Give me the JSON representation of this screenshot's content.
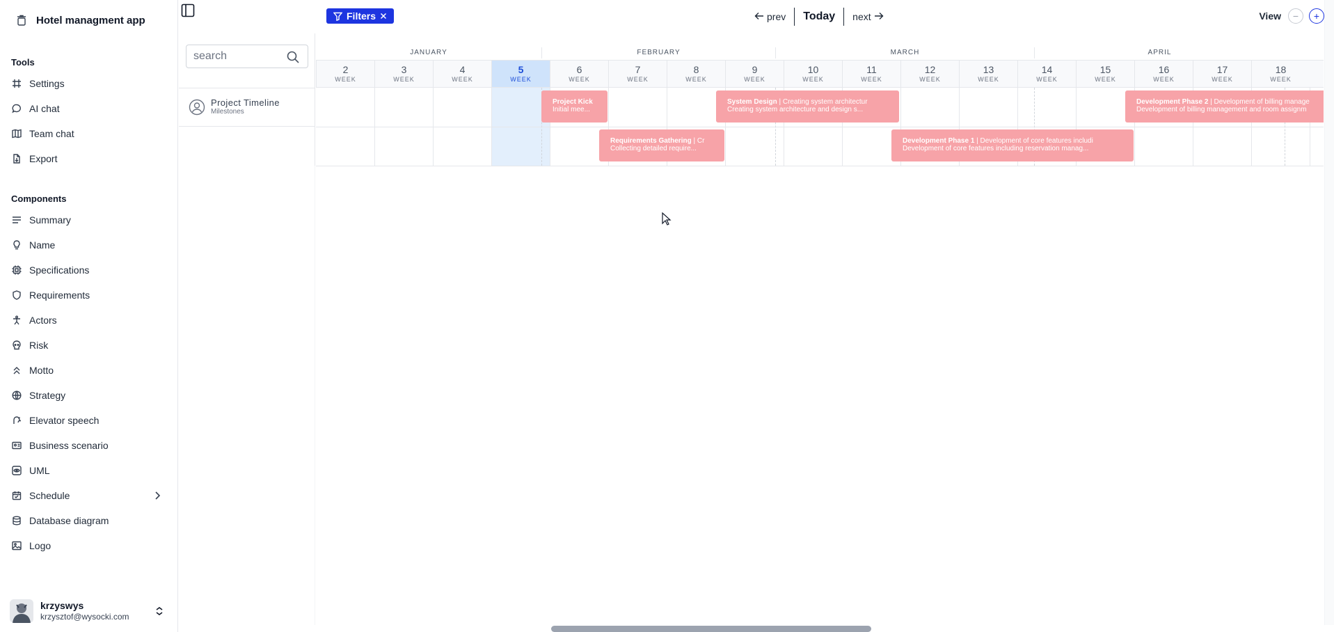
{
  "app": {
    "title": "Hotel managment app"
  },
  "sidebar": {
    "tools_label": "Tools",
    "tools": [
      {
        "label": "Settings",
        "icon": "hash-icon"
      },
      {
        "label": "AI chat",
        "icon": "chat-icon"
      },
      {
        "label": "Team chat",
        "icon": "book-icon"
      },
      {
        "label": "Export",
        "icon": "file-export-icon"
      }
    ],
    "components_label": "Components",
    "components": [
      {
        "label": "Summary",
        "icon": "lines-icon"
      },
      {
        "label": "Name",
        "icon": "lightbulb-icon"
      },
      {
        "label": "Specifications",
        "icon": "cpu-icon"
      },
      {
        "label": "Requirements",
        "icon": "shield-icon"
      },
      {
        "label": "Actors",
        "icon": "person-icon"
      },
      {
        "label": "Risk",
        "icon": "risk-icon"
      },
      {
        "label": "Motto",
        "icon": "double-chevron-up-icon"
      },
      {
        "label": "Strategy",
        "icon": "globe-icon"
      },
      {
        "label": "Elevator speech",
        "icon": "speech-icon"
      },
      {
        "label": "Business scenario",
        "icon": "id-card-icon"
      },
      {
        "label": "UML",
        "icon": "eye-icon"
      },
      {
        "label": "Schedule",
        "icon": "calendar-icon"
      },
      {
        "label": "Database diagram",
        "icon": "database-icon"
      },
      {
        "label": "Logo",
        "icon": "image-icon"
      }
    ],
    "user": {
      "name": "krzyswys",
      "email": "krzysztof@wysocki.com"
    }
  },
  "search": {
    "placeholder": "search"
  },
  "resource": {
    "name": "Project Timeline",
    "subtitle": "Milestones"
  },
  "toolbar": {
    "filters_label": "Filters",
    "prev_label": "prev",
    "today_label": "Today",
    "next_label": "next",
    "view_label": "View",
    "zoom_out": "−",
    "zoom_in": "+"
  },
  "timeline": {
    "months": [
      "JANUARY",
      "FEBRUARY",
      "MARCH",
      "APRIL"
    ],
    "weeks": [
      {
        "num": "2",
        "label": "WEEK"
      },
      {
        "num": "3",
        "label": "WEEK"
      },
      {
        "num": "4",
        "label": "WEEK"
      },
      {
        "num": "5",
        "label": "WEEK"
      },
      {
        "num": "6",
        "label": "WEEK"
      },
      {
        "num": "7",
        "label": "WEEK"
      },
      {
        "num": "8",
        "label": "WEEK"
      },
      {
        "num": "9",
        "label": "WEEK"
      },
      {
        "num": "10",
        "label": "WEEK"
      },
      {
        "num": "11",
        "label": "WEEK"
      },
      {
        "num": "12",
        "label": "WEEK"
      },
      {
        "num": "13",
        "label": "WEEK"
      },
      {
        "num": "14",
        "label": "WEEK"
      },
      {
        "num": "15",
        "label": "WEEK"
      },
      {
        "num": "16",
        "label": "WEEK"
      },
      {
        "num": "17",
        "label": "WEEK"
      },
      {
        "num": "18",
        "label": "WEEK"
      }
    ],
    "current_week": "5",
    "events": [
      {
        "title": "Project Kick",
        "desc": "Initial mee..."
      },
      {
        "title": "System Design",
        "sep": " | ",
        "detail": "Creating system architectur",
        "desc": "Creating system architecture and design s..."
      },
      {
        "title": "Development Phase 2",
        "sep": " | ",
        "detail": "Development of billing manage",
        "desc": "Development of billing management and room assignm"
      },
      {
        "title": "Requirements Gathering",
        "sep": " | ",
        "detail": "Cr",
        "desc": "Collecting detailed require..."
      },
      {
        "title": "Development Phase 1",
        "sep": " | ",
        "detail": "Development of core features includi",
        "desc": "Development of core features including reservation manag..."
      }
    ],
    "event_color": "#f7a3a8"
  },
  "colors": {
    "accent": "#1d35e0",
    "current_week": "#cfe3fb"
  }
}
